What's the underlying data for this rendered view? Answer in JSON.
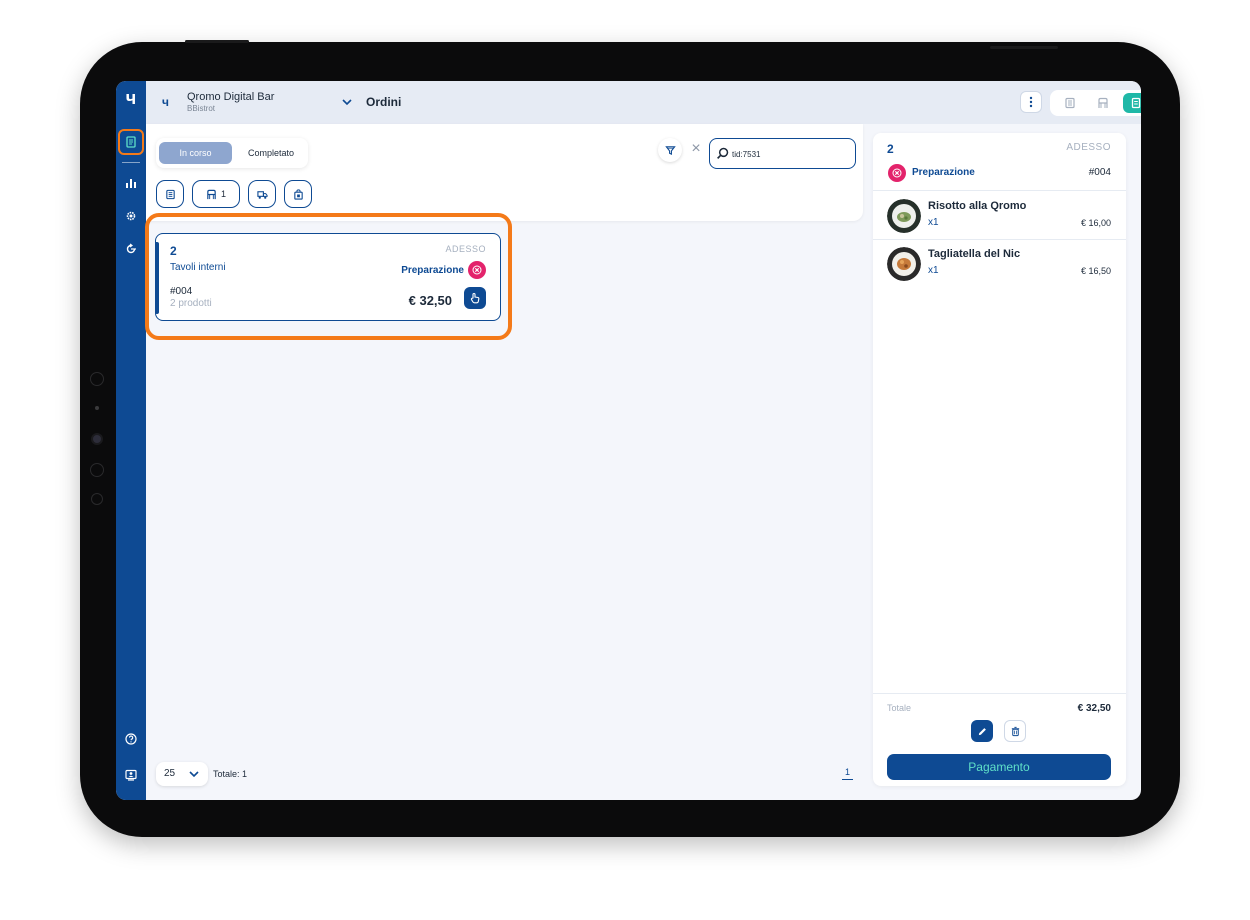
{
  "sidebar": {
    "logo": "ч",
    "items": [
      {
        "name": "orders",
        "icon": "orders-icon",
        "active": true
      },
      {
        "name": "analytics",
        "icon": "bar-chart-icon"
      },
      {
        "name": "settings",
        "icon": "gear-icon"
      },
      {
        "name": "refresh",
        "icon": "refresh-icon"
      },
      {
        "name": "help",
        "icon": "help-icon"
      },
      {
        "name": "account",
        "icon": "account-icon"
      }
    ]
  },
  "header": {
    "venue_name": "Qromo Digital Bar",
    "venue_sub": "BBistrot",
    "title": "Ordini",
    "views": [
      "menu-view",
      "table-view",
      "orders-view"
    ]
  },
  "filters": {
    "tab_active": "In corso",
    "tab_inactive": "Completato",
    "search_value": "tid:7531",
    "table_count": "1"
  },
  "order": {
    "table": "2",
    "when": "ADESSO",
    "area": "Tavoli interni",
    "status": "Preparazione",
    "code": "#004",
    "count": "2 prodotti",
    "total": "€ 32,50"
  },
  "pager": {
    "page_size": "25",
    "total": "Totale: 1",
    "page": "1"
  },
  "detail": {
    "table": "2",
    "when": "ADESSO",
    "status": "Preparazione",
    "code": "#004",
    "items": [
      {
        "name": "Risotto alla Qromo",
        "qty": "x1",
        "price": "€ 16,00"
      },
      {
        "name": "Tagliatella del Nic",
        "qty": "x1",
        "price": "€ 16,50"
      }
    ],
    "total_label": "Totale",
    "total_value": "€ 32,50",
    "pay_label": "Pagamento"
  },
  "colors": {
    "brand": "#0e4a93",
    "accent": "#1fb8a7",
    "status": "#e3236b",
    "highlight": "#f47a19"
  }
}
